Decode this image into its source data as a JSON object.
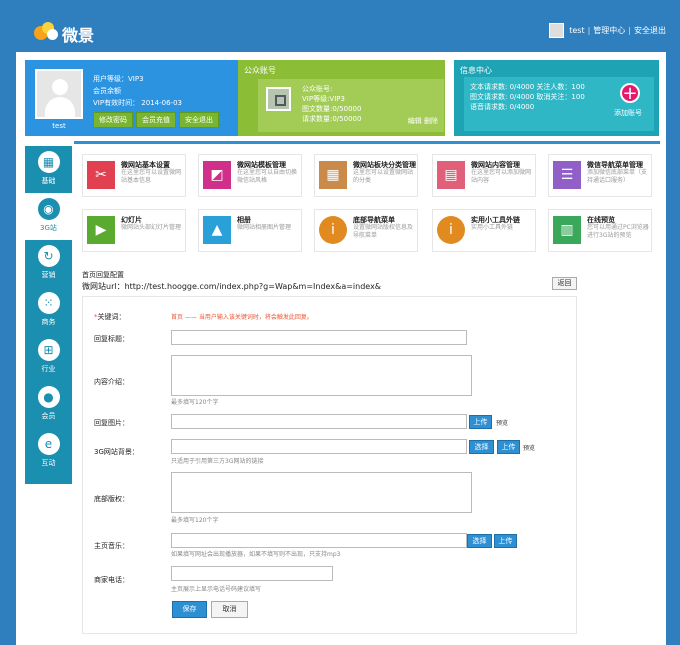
{
  "header": {
    "logo_text": "微景",
    "username": "test",
    "manage_link": "管理中心",
    "logout_link": "安全退出"
  },
  "user_panel": {
    "username": "test",
    "level": "用户等级：VIP3",
    "balance": "会员余额",
    "vip_expire": "VIP有效时间： 2014-06-03",
    "btn_change_pwd": "修改密码",
    "btn_recharge": "会员充值",
    "btn_logout": "安全退出"
  },
  "public_panel": {
    "title": "公众账号",
    "account": "公众账号:",
    "vip": "VIP等级:VIP3",
    "text_count": "图文数量:0/50000",
    "req_count": "请求数量:0/50000",
    "edit": "编辑",
    "delete": "删除"
  },
  "message_panel": {
    "title": "信息中心",
    "line1": "文本请求数: 0/4000  关注人数：100",
    "line2": "图文请求数: 0/4000  取消关注：100",
    "line3": "语音请求数: 0/4000",
    "add_label": "添加账号"
  },
  "sidebar": {
    "items": [
      {
        "label": "基础",
        "icon": "grid-icon"
      },
      {
        "label": "3G站",
        "icon": "signal-icon"
      },
      {
        "label": "营销",
        "icon": "refresh-icon"
      },
      {
        "label": "商务",
        "icon": "dots-icon"
      },
      {
        "label": "行业",
        "icon": "windows-icon"
      },
      {
        "label": "会员",
        "icon": "person-icon"
      },
      {
        "label": "互动",
        "icon": "ie-icon"
      }
    ]
  },
  "tiles": [
    {
      "title": "微网站基本设置",
      "desc": "在这里您可以设置微网站基本信息",
      "color": "#e04050",
      "icon": "tools-icon"
    },
    {
      "title": "微网站模板管理",
      "desc": "在这里您可以自由切换微信站风格",
      "color": "#d0308a",
      "icon": "template-icon"
    },
    {
      "title": "微网站板块分类管理",
      "desc": "这里您可以设置微网站的分类",
      "color": "#c98a4a",
      "icon": "grid-icon"
    },
    {
      "title": "微网站内容管理",
      "desc": "在这里您可以添加微网站内容",
      "color": "#e0607a",
      "icon": "document-icon"
    },
    {
      "title": "微信导航菜单管理",
      "desc": "添加微信底部菜单（支持通话口服务）",
      "color": "#9060c8",
      "icon": "list-icon"
    },
    {
      "title": "幻灯片",
      "desc": "微网站头部幻灯片管理",
      "color": "#5aaa30",
      "icon": "video-icon"
    },
    {
      "title": "相册",
      "desc": "微网站相册图片管理",
      "color": "#2aa0d8",
      "icon": "image-icon"
    },
    {
      "title": "底部导航菜单",
      "desc": "设置微网站版权信息及导航菜单",
      "color": "#e08a20",
      "icon": "info-icon"
    },
    {
      "title": "实用小工具外链",
      "desc": "实用小工具外链",
      "color": "#e08a20",
      "icon": "info-icon"
    },
    {
      "title": "在线预览",
      "desc": "您可以用通过PC浏览器进行3G站的预览",
      "color": "#3aa85a",
      "icon": "map-icon"
    }
  ],
  "form": {
    "config_title": "首页回复配置",
    "site_url": "微网站url：http://test.hoogge.com/index.php?g=Wap&m=Index&a=index&",
    "back_btn": "返回",
    "keyword_label": "关键词：",
    "keyword_value": "首页 —— 当用户输入该关键词时，将会触发此回复。",
    "title_label": "回复标题：",
    "intro_label": "内容介绍：",
    "intro_note": "最多填写120个字",
    "image_label": "回复图片：",
    "bg_label": "3G网站背景：",
    "bg_note": "只适用于引用第三方3G网站的链接",
    "copyright_label": "底部版权：",
    "copyright_note": "最多填写120个字",
    "music_label": "主页音乐：",
    "music_note": "如果填写网址会出现播放器，如果不填写则不出现，只支持mp3",
    "phone_label": "商家电话：",
    "phone_note": "主页展示上显示电话号码建议填写",
    "upload": "上传",
    "preview": "预览",
    "select": "选择",
    "save": "保存",
    "cancel": "取消"
  }
}
